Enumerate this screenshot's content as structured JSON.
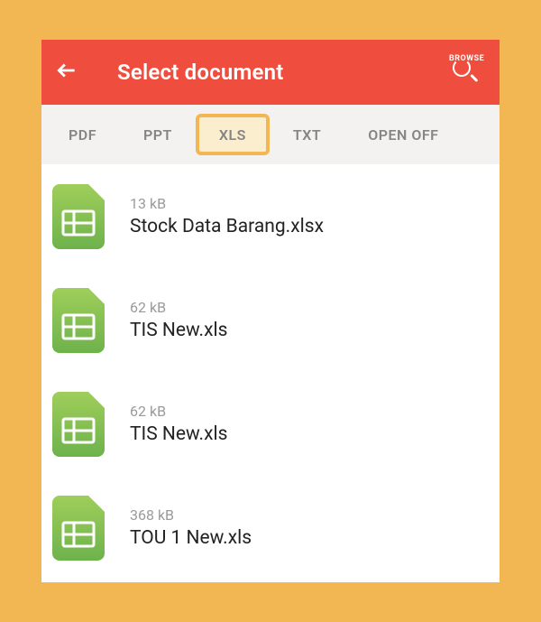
{
  "header": {
    "title": "Select document",
    "browse_label": "BROWSE"
  },
  "tabs": [
    {
      "label": "PDF",
      "active": false
    },
    {
      "label": "PPT",
      "active": false
    },
    {
      "label": "XLS",
      "active": true
    },
    {
      "label": "TXT",
      "active": false
    },
    {
      "label": "OPEN OFF",
      "active": false
    }
  ],
  "files": [
    {
      "size": "13 kB",
      "name": "Stock Data Barang.xlsx"
    },
    {
      "size": "62 kB",
      "name": "TIS New.xls"
    },
    {
      "size": "62 kB",
      "name": "TIS New.xls"
    },
    {
      "size": "368 kB",
      "name": "TOU 1 New.xls"
    }
  ],
  "colors": {
    "accent": "#ef4d3d",
    "highlight": "#f2b653",
    "xls_icon_top": "#9fce5a",
    "xls_icon_bottom": "#6eb24c"
  }
}
